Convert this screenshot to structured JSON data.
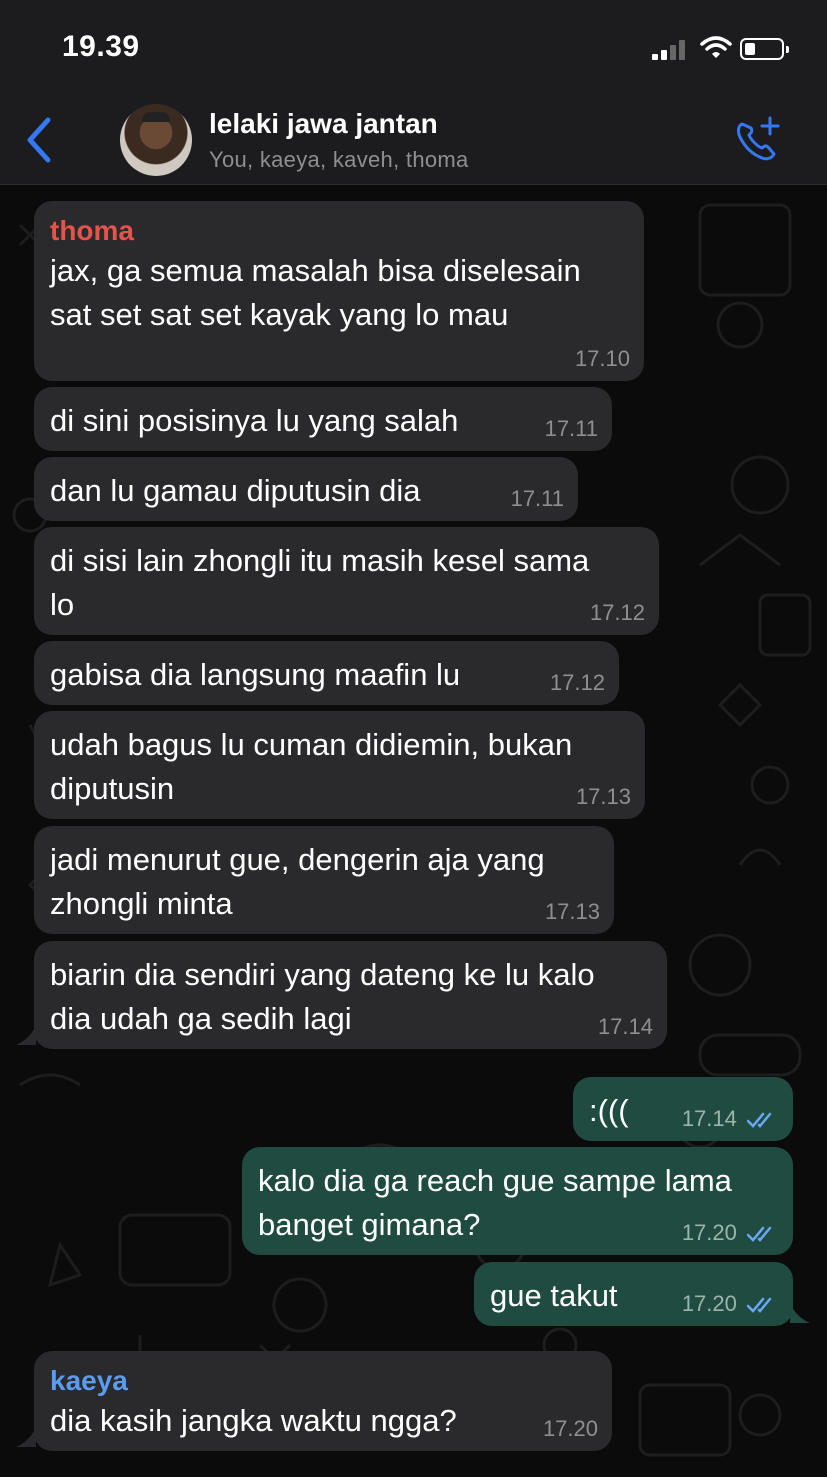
{
  "status_bar": {
    "time": "19.39"
  },
  "header": {
    "title": "lelaki jawa jantan",
    "members": "You, kaeya, kaveh, thoma"
  },
  "colors": {
    "accent": "#3478f6",
    "incoming_bubble": "#2a2a2c",
    "outgoing_bubble": "#1f4b40",
    "sender_thoma": "#e5534b",
    "sender_kaeya": "#5b9cf0",
    "read_ticks": "#6aa8f5"
  },
  "messages": [
    {
      "direction": "in",
      "sender": "thoma",
      "text_line1": "jax, ga semua masalah bisa diselesain",
      "text_line2": "sat set sat set kayak yang lo mau",
      "time": "17.10"
    },
    {
      "direction": "in",
      "text_line1": "di sini posisinya lu yang salah",
      "time": "17.11"
    },
    {
      "direction": "in",
      "text_line1": "dan lu gamau diputusin dia",
      "time": "17.11"
    },
    {
      "direction": "in",
      "text_line1": "di sisi lain zhongli itu masih kesel sama",
      "text_line2": "lo",
      "time": "17.12"
    },
    {
      "direction": "in",
      "text_line1": "gabisa dia langsung maafin lu",
      "time": "17.12"
    },
    {
      "direction": "in",
      "text_line1": "udah bagus lu cuman didiemin, bukan",
      "text_line2": "diputusin",
      "time": "17.13"
    },
    {
      "direction": "in",
      "text_line1": "jadi menurut gue, dengerin aja yang",
      "text_line2": "zhongli minta",
      "time": "17.13"
    },
    {
      "direction": "in",
      "text_line1": "biarin dia sendiri yang dateng ke lu kalo",
      "text_line2": "dia udah ga sedih lagi",
      "time": "17.14"
    },
    {
      "direction": "out",
      "text_line1": ":(((",
      "time": "17.14"
    },
    {
      "direction": "out",
      "text_line1": "kalo dia ga reach gue sampe lama",
      "text_line2": "banget gimana?",
      "time": "17.20"
    },
    {
      "direction": "out",
      "text_line1": "gue takut",
      "time": "17.20"
    },
    {
      "direction": "in",
      "sender": "kaeya",
      "text_line1": "dia kasih jangka waktu ngga?",
      "time": "17.20"
    }
  ]
}
